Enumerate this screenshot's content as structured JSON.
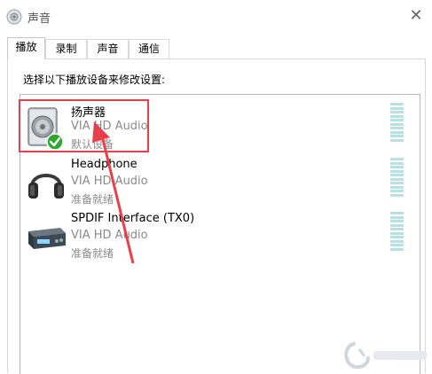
{
  "window": {
    "title": "声音",
    "close_label": "✕"
  },
  "tabs": [
    {
      "label": "播放",
      "active": true
    },
    {
      "label": "录制",
      "active": false
    },
    {
      "label": "声音",
      "active": false
    },
    {
      "label": "通信",
      "active": false
    }
  ],
  "instruction": "选择以下播放设备来修改设置:",
  "devices": [
    {
      "name": "扬声器",
      "driver": "VIA HD Audio",
      "status": "默认设备",
      "icon": "speaker-icon",
      "is_default": true,
      "selected": true
    },
    {
      "name": "Headphone",
      "driver": "VIA HD Audio",
      "status": "准备就绪",
      "icon": "headphone-icon",
      "is_default": false,
      "selected": false
    },
    {
      "name": "SPDIF Interface (TX0)",
      "driver": "VIA HD Audio",
      "status": "准备就绪",
      "icon": "spdif-device-icon",
      "is_default": false,
      "selected": false
    }
  ],
  "annotation": {
    "color": "#e8404a"
  },
  "colors": {
    "meter": "#b8e0e6",
    "default_check": "#2fa82f",
    "status_text": "#8a8a8a"
  }
}
